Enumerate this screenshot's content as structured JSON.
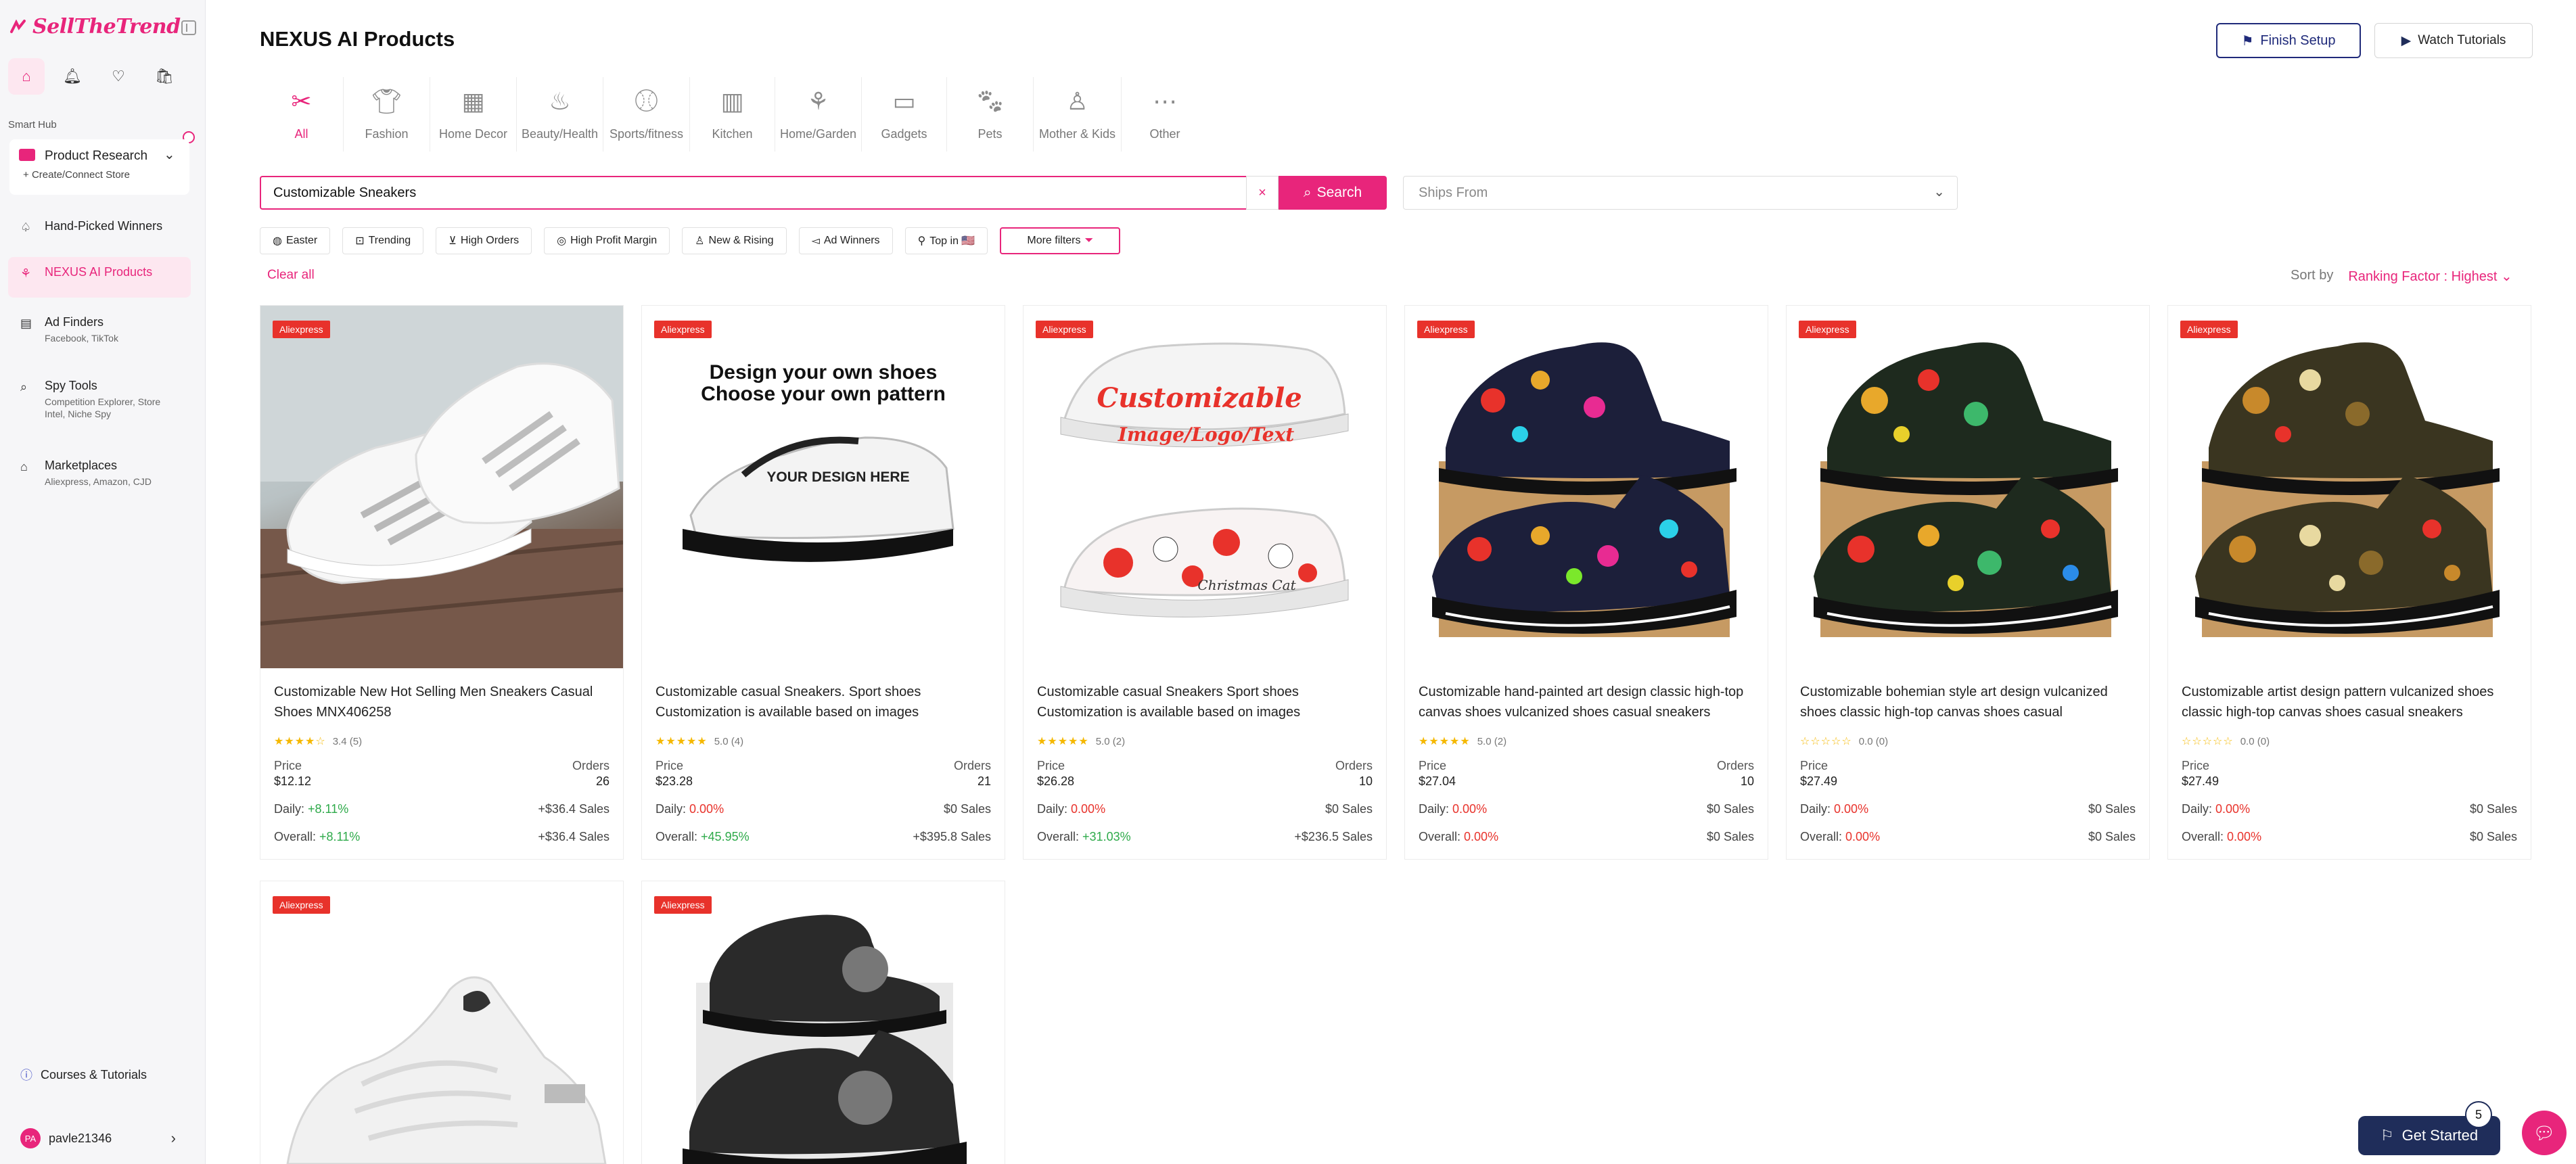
{
  "brand": {
    "name": "SellTheTrend"
  },
  "sidebar": {
    "section_label": "Smart Hub",
    "product_research": {
      "title": "Product Research",
      "sub": "Create/Connect Store"
    },
    "items": [
      {
        "title": "Hand-Picked Winners",
        "sub": ""
      },
      {
        "title": "NEXUS AI Products",
        "sub": ""
      },
      {
        "title": "Ad Finders",
        "sub": "Facebook, TikTok"
      },
      {
        "title": "Spy Tools",
        "sub": "Competition Explorer, Store Intel, Niche Spy"
      },
      {
        "title": "Marketplaces",
        "sub": "Aliexpress, Amazon, CJD"
      }
    ],
    "courses": "Courses & Tutorials",
    "user": {
      "initials": "PA",
      "name": "pavle21346"
    }
  },
  "header": {
    "title": "NEXUS AI Products",
    "finish_setup": "Finish Setup",
    "watch_tutorials": "Watch Tutorials"
  },
  "categories": [
    "All",
    "Fashion",
    "Home Decor",
    "Beauty/Health",
    "Sports/fitness",
    "Kitchen",
    "Home/Garden",
    "Gadgets",
    "Pets",
    "Mother & Kids",
    "Other"
  ],
  "search": {
    "value": "Customizable Sneakers",
    "clear": "×",
    "button": "Search",
    "ships_from_placeholder": "Ships From"
  },
  "filters": [
    "Easter",
    "Trending",
    "High Orders",
    "High Profit Margin",
    "New & Rising",
    "Ad Winners",
    "Top in 🇺🇸",
    "More filters"
  ],
  "clear_all": "Clear all",
  "sort": {
    "label": "Sort by",
    "value": "Ranking Factor : Highest"
  },
  "products": [
    {
      "source": "Aliexpress",
      "title": "Customizable New Hot Selling Men Sneakers Casual Shoes MNX406258",
      "rating": "3.4 (5)",
      "stars": "★★★★☆",
      "price_label": "Price",
      "price": "$12.12",
      "orders_label": "Orders",
      "orders": "26",
      "daily_label": "Daily:",
      "daily": "+8.11%",
      "daily_sales": "+$36.4 Sales",
      "overall_label": "Overall:",
      "overall": "+8.11%",
      "overall_sales": "+$36.4 Sales"
    },
    {
      "source": "Aliexpress",
      "title": "Customizable casual Sneakers. Sport shoes Customization is available based on images",
      "rating": "5.0 (4)",
      "stars": "★★★★★",
      "price_label": "Price",
      "price": "$23.28",
      "orders_label": "Orders",
      "orders": "21",
      "daily_label": "Daily:",
      "daily": "0.00%",
      "daily_sales": "$0 Sales",
      "overall_label": "Overall:",
      "overall": "+45.95%",
      "overall_sales": "+$395.8 Sales"
    },
    {
      "source": "Aliexpress",
      "title": "Customizable casual Sneakers Sport shoes Customization is available based on images",
      "rating": "5.0 (2)",
      "stars": "★★★★★",
      "price_label": "Price",
      "price": "$26.28",
      "orders_label": "Orders",
      "orders": "10",
      "daily_label": "Daily:",
      "daily": "0.00%",
      "daily_sales": "$0 Sales",
      "overall_label": "Overall:",
      "overall": "+31.03%",
      "overall_sales": "+$236.5 Sales"
    },
    {
      "source": "Aliexpress",
      "title": "Customizable hand-painted art design classic high-top canvas shoes vulcanized shoes casual sneakers",
      "rating": "5.0 (2)",
      "stars": "★★★★★",
      "price_label": "Price",
      "price": "$27.04",
      "orders_label": "Orders",
      "orders": "10",
      "daily_label": "Daily:",
      "daily": "0.00%",
      "daily_sales": "$0 Sales",
      "overall_label": "Overall:",
      "overall": "0.00%",
      "overall_sales": "$0 Sales"
    },
    {
      "source": "Aliexpress",
      "title": "Customizable bohemian style art design vulcanized shoes classic high-top canvas shoes casual",
      "rating": "0.0 (0)",
      "stars": "☆☆☆☆☆",
      "price_label": "Price",
      "price": "$27.49",
      "orders_label": "",
      "orders": "",
      "daily_label": "Daily:",
      "daily": "0.00%",
      "daily_sales": "$0 Sales",
      "overall_label": "Overall:",
      "overall": "0.00%",
      "overall_sales": "$0 Sales"
    },
    {
      "source": "Aliexpress",
      "title": "Customizable artist design pattern vulcanized shoes classic high-top canvas shoes casual sneakers",
      "rating": "0.0 (0)",
      "stars": "☆☆☆☆☆",
      "price_label": "Price",
      "price": "$27.49",
      "orders_label": "",
      "orders": "",
      "daily_label": "Daily:",
      "daily": "0.00%",
      "daily_sales": "$0 Sales",
      "overall_label": "Overall:",
      "overall": "0.00%",
      "overall_sales": "$0 Sales"
    },
    {
      "source": "Aliexpress"
    },
    {
      "source": "Aliexpress"
    }
  ],
  "image_text": {
    "p2_line1": "Design your own shoes",
    "p2_line2": "Choose your own pattern",
    "p2_heel": "YOUR DESIGN HERE",
    "p3_line1": "Customizable",
    "p3_line2": "Image/Logo/Text",
    "p3_heel": "Christmas Cat"
  },
  "floating": {
    "get_started": "Get Started",
    "count": "5"
  }
}
